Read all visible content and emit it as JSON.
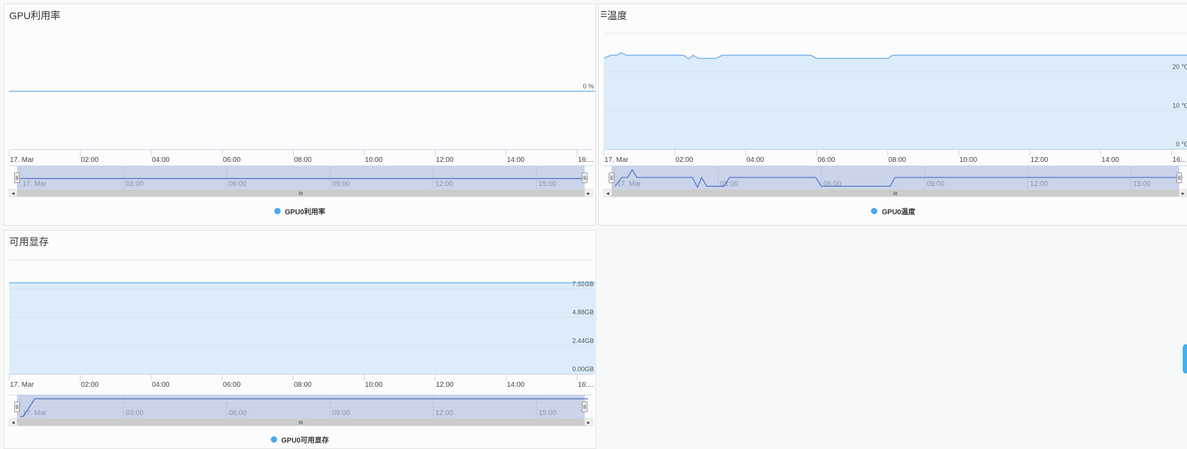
{
  "colors": {
    "accent": "#7cb5ec",
    "fill": "#dcecfa",
    "navigator_mask": "#c9d3ea",
    "navigator_line": "#4b6fc0",
    "legend_dot": "#4aa8f0",
    "side_tab": "#3fb0f0",
    "scrollbar": "#cccccc"
  },
  "panels": [
    {
      "title": "GPU利用率",
      "legend": "GPU0利用率"
    },
    {
      "title": "温度",
      "title_prefix_icon": "menu-icon",
      "legend": "GPU0温度"
    },
    {
      "title": "可用显存",
      "legend": "GPU0可用显存"
    }
  ],
  "scrollbar": {
    "grip": "III",
    "left_arrow": "◂",
    "right_arrow": "▸"
  },
  "chart_data": [
    {
      "type": "line",
      "title": "GPU利用率",
      "series": [
        {
          "name": "GPU0利用率",
          "points": [
            [
              "00:00",
              0
            ],
            [
              "16:30",
              0
            ]
          ]
        }
      ],
      "x_ticks": [
        "17. Mar",
        "02:00",
        "04:00",
        "06:00",
        "08:00",
        "10:00",
        "12:00",
        "14:00",
        "16:..."
      ],
      "navigator_ticks": [
        "17. Mar",
        "03:00",
        "06:00",
        "09:00",
        "12:00",
        "15:00"
      ],
      "y_ticks": [
        {
          "value": 0,
          "label": "0 %"
        }
      ],
      "ylim": [
        -1,
        1
      ],
      "top_gridline": false,
      "area": false
    },
    {
      "type": "area",
      "title": "温度",
      "series": [
        {
          "name": "GPU0温度",
          "points": [
            [
              "00:00",
              23.5
            ],
            [
              "00:12",
              24.3
            ],
            [
              "00:22",
              24.3
            ],
            [
              "00:30",
              25.0
            ],
            [
              "00:38",
              24.3
            ],
            [
              "02:15",
              24.3
            ],
            [
              "02:24",
              23.4
            ],
            [
              "02:31",
              24.3
            ],
            [
              "02:40",
              23.5
            ],
            [
              "03:10",
              23.5
            ],
            [
              "03:20",
              24.3
            ],
            [
              "05:50",
              24.3
            ],
            [
              "06:00",
              23.5
            ],
            [
              "08:00",
              23.5
            ],
            [
              "08:08",
              24.3
            ],
            [
              "16:30",
              24.3
            ]
          ]
        }
      ],
      "x_ticks": [
        "17. Mar",
        "02:00",
        "04:00",
        "06:00",
        "08:00",
        "10:00",
        "12:00",
        "14:00",
        "16:..."
      ],
      "navigator_ticks": [
        "17. Mar",
        "03:00",
        "06:00",
        "09:00",
        "12:00",
        "15:00"
      ],
      "y_ticks": [
        {
          "value": 0,
          "label": "0 ℃"
        },
        {
          "value": 10,
          "label": "10 ℃"
        },
        {
          "value": 20,
          "label": "20 ℃"
        }
      ],
      "ylim": [
        0,
        30
      ],
      "top_gridline": true,
      "area": true
    },
    {
      "type": "area",
      "title": "可用显存",
      "series": [
        {
          "name": "GPU0可用显存",
          "points": [
            [
              "00:00",
              7.82
            ],
            [
              "16:30",
              7.82
            ]
          ],
          "navigator_points": [
            [
              "00:00",
              0
            ],
            [
              "00:05",
              0
            ],
            [
              "00:25",
              7.82
            ],
            [
              "16:30",
              7.82
            ]
          ]
        }
      ],
      "x_ticks": [
        "17. Mar",
        "02:00",
        "04:00",
        "06:00",
        "08:00",
        "10:00",
        "12:00",
        "14:00",
        "16:..."
      ],
      "navigator_ticks": [
        "17. Mar",
        "03:00",
        "06:00",
        "09:00",
        "12:00",
        "15:00"
      ],
      "y_ticks": [
        {
          "value": 0,
          "label": "0.00GB"
        },
        {
          "value": 2.44,
          "label": "2.44GB"
        },
        {
          "value": 4.88,
          "label": "4.88GB"
        },
        {
          "value": 7.32,
          "label": "7.32GB"
        }
      ],
      "ylim": [
        0,
        9.76
      ],
      "top_gridline": true,
      "area": true
    }
  ]
}
